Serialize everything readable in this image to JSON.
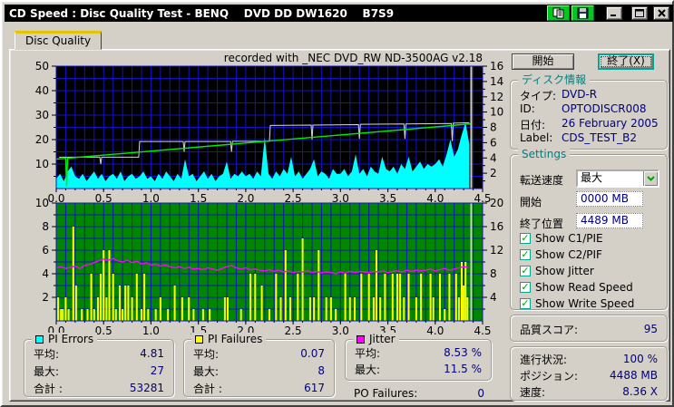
{
  "window": {
    "title": "CD Speed : Disc Quality Test - BENQ    DVD DD DW1620    B7S9"
  },
  "colors": {
    "window_bg": "#d4d0c8",
    "titlebar": "#000000",
    "value_text": "#000080",
    "group_title": "#008080",
    "default_button_border": "#00a693",
    "check_green": "#00a000"
  },
  "icons": {
    "check_glyph": "✓"
  },
  "tab": {
    "label": "Disc Quality"
  },
  "chart_header": "recorded with _NEC      DVD_RW ND-3500AG v2.18",
  "buttons": {
    "start": "開始",
    "exit": "終了(X)"
  },
  "disc_info": {
    "title": "ディスク情報",
    "rows": [
      {
        "label": "タイプ:",
        "value": "DVD-R"
      },
      {
        "label": "ID:",
        "value": "OPTODISCR008"
      },
      {
        "label": "日付:",
        "value": "26 February 2005"
      },
      {
        "label": "Label:",
        "value": "CDS_TEST_B2"
      }
    ]
  },
  "settings": {
    "title": "Settings",
    "speed_label": "転送速度",
    "speed_value": "最大",
    "start_label": "開始",
    "start_value": "0000 MB",
    "end_label": "終了位置",
    "end_value": "4489 MB",
    "checkboxes": [
      {
        "label": "Show C1/PIE",
        "checked": true
      },
      {
        "label": "Show C2/PIF",
        "checked": true
      },
      {
        "label": "Show Jitter",
        "checked": true
      },
      {
        "label": "Show Read Speed",
        "checked": true
      },
      {
        "label": "Show Write Speed",
        "checked": true
      }
    ]
  },
  "quality": {
    "label": "品質スコア:",
    "value": "95"
  },
  "progress": {
    "rows": [
      {
        "label": "進行状況:",
        "value": "100 %"
      },
      {
        "label": "ポジション:",
        "value": "4488 MB"
      },
      {
        "label": "速度:",
        "value": "8.36 X"
      }
    ]
  },
  "stats": {
    "pi_errors": {
      "title": "PI Errors",
      "swatch": "#00ffff",
      "rows": [
        {
          "label": "平均:",
          "value": "4.81"
        },
        {
          "label": "最大:",
          "value": "27"
        },
        {
          "label": "合計 :",
          "value": "53281"
        }
      ]
    },
    "pi_failures": {
      "title": "PI Failures",
      "swatch": "#ffff00",
      "rows": [
        {
          "label": "平均:",
          "value": "0.07"
        },
        {
          "label": "最大:",
          "value": "8"
        },
        {
          "label": "合計 :",
          "value": "617"
        }
      ]
    },
    "jitter": {
      "title": "Jitter",
      "swatch": "#ff00ff",
      "rows": [
        {
          "label": "平均:",
          "value": "8.53 %"
        },
        {
          "label": "最大:",
          "value": "11.5 %"
        }
      ]
    },
    "po_failures": {
      "label": "PO Failures:",
      "value": "0"
    }
  },
  "chart_data": [
    {
      "type": "area",
      "name": "pi-errors-and-speed",
      "bg": "#000000",
      "grid": "#1212c8",
      "marker_x": 4.38,
      "marker_color": "#cccccc",
      "x_range": [
        0,
        4.5
      ],
      "x_ticks": [
        0,
        0.5,
        1,
        1.5,
        2,
        2.5,
        3,
        3.5,
        4,
        4.5
      ],
      "x_minor_step": 0.1,
      "left_axis": {
        "range": [
          0,
          50
        ],
        "ticks": [
          10,
          20,
          30,
          40,
          50
        ],
        "grid_step": 5
      },
      "right_axis": {
        "range": [
          0,
          16
        ],
        "ticks": [
          2,
          4,
          6,
          8,
          10,
          12,
          14,
          16
        ]
      },
      "series": [
        {
          "name": "PI Errors",
          "type": "area",
          "axis": "left",
          "color": "#00ffff",
          "x_start": 0,
          "x_step": 0.04,
          "values": [
            4,
            6,
            3,
            7,
            9,
            5,
            4,
            6,
            3,
            5,
            7,
            4,
            6,
            3,
            5,
            6,
            4,
            7,
            3,
            5,
            6,
            4,
            5,
            7,
            4,
            5,
            3,
            6,
            4,
            7,
            5,
            3,
            6,
            4,
            12,
            5,
            6,
            3,
            5,
            7,
            4,
            6,
            3,
            5,
            6,
            11,
            4,
            6,
            5,
            7,
            5,
            6,
            4,
            7,
            5,
            21,
            6,
            4,
            7,
            5,
            8,
            6,
            13,
            5,
            7,
            4,
            6,
            8,
            12,
            5,
            7,
            6,
            4,
            8,
            6,
            6,
            8,
            5,
            7,
            14,
            6,
            8,
            5,
            9,
            7,
            6,
            13,
            8,
            7,
            9,
            6,
            10,
            8,
            13,
            7,
            9,
            11,
            8,
            10,
            9,
            10,
            12,
            9,
            14,
            20,
            13,
            16,
            22,
            27,
            18
          ]
        },
        {
          "name": "Write Speed",
          "type": "line",
          "axis": "right",
          "color": "#d8d8d8",
          "width": 1,
          "points": [
            [
              0.03,
              4.1
            ],
            [
              0.46,
              4.1
            ],
            [
              0.47,
              3.2
            ],
            [
              0.48,
              4.1
            ],
            [
              0.87,
              4.1
            ],
            [
              0.88,
              6.15
            ],
            [
              1.34,
              6.15
            ],
            [
              1.35,
              4.8
            ],
            [
              1.36,
              6.15
            ],
            [
              1.84,
              6.15
            ],
            [
              1.85,
              4.8
            ],
            [
              1.86,
              6.18
            ],
            [
              2.25,
              6.18
            ],
            [
              2.26,
              8.25
            ],
            [
              2.69,
              8.3
            ],
            [
              2.7,
              6.4
            ],
            [
              2.71,
              8.3
            ],
            [
              3.19,
              8.35
            ],
            [
              3.2,
              6.5
            ],
            [
              3.21,
              8.4
            ],
            [
              3.67,
              8.45
            ],
            [
              3.68,
              6.5
            ],
            [
              3.69,
              8.45
            ],
            [
              4.17,
              8.5
            ],
            [
              4.18,
              6.2
            ],
            [
              4.19,
              8.55
            ],
            [
              4.36,
              8.6
            ]
          ]
        },
        {
          "name": "Read Speed",
          "type": "line",
          "axis": "right",
          "color": "#00ee00",
          "width": 1.4,
          "points": [
            [
              0,
              3.85
            ],
            [
              0.1,
              3.95
            ],
            [
              0.11,
              0.3
            ],
            [
              0.12,
              3.97
            ],
            [
              4.37,
              8.45
            ]
          ]
        }
      ]
    },
    {
      "type": "bar",
      "name": "pi-failures-and-jitter",
      "bg": "#008700",
      "grid": "#1212c8",
      "marker_x": 4.38,
      "marker_color": "#cccccc",
      "x_range": [
        0,
        4.5
      ],
      "x_ticks": [
        0,
        0.5,
        1,
        1.5,
        2,
        2.5,
        3,
        3.5,
        4,
        4.5
      ],
      "x_minor_step": 0.1,
      "left_axis": {
        "range": [
          0,
          10
        ],
        "ticks": [
          2,
          4,
          6,
          8,
          10
        ],
        "grid_step": 1
      },
      "right_axis": {
        "range": [
          0,
          20
        ],
        "ticks": [
          4,
          8,
          12,
          16,
          20
        ]
      },
      "series": [
        {
          "name": "PI Failures",
          "type": "bars",
          "axis": "left",
          "color": "#ffff00",
          "points": [
            [
              0.02,
              2
            ],
            [
              0.05,
              1
            ],
            [
              0.07,
              1
            ],
            [
              0.1,
              2
            ],
            [
              0.13,
              1
            ],
            [
              0.18,
              8
            ],
            [
              0.21,
              3
            ],
            [
              0.27,
              1
            ],
            [
              0.33,
              1
            ],
            [
              0.37,
              4
            ],
            [
              0.4,
              1
            ],
            [
              0.44,
              2
            ],
            [
              0.47,
              4
            ],
            [
              0.5,
              6
            ],
            [
              0.53,
              2
            ],
            [
              0.56,
              6
            ],
            [
              0.6,
              4
            ],
            [
              0.63,
              1
            ],
            [
              0.67,
              3
            ],
            [
              0.7,
              1
            ],
            [
              0.73,
              3
            ],
            [
              0.76,
              3
            ],
            [
              0.8,
              2
            ],
            [
              0.85,
              4
            ],
            [
              0.9,
              1
            ],
            [
              0.93,
              4
            ],
            [
              0.97,
              1
            ],
            [
              1.05,
              1
            ],
            [
              1.1,
              2
            ],
            [
              1.18,
              1
            ],
            [
              1.25,
              3
            ],
            [
              1.33,
              2
            ],
            [
              1.4,
              2
            ],
            [
              1.45,
              1
            ],
            [
              1.55,
              1
            ],
            [
              1.62,
              1
            ],
            [
              1.78,
              2
            ],
            [
              1.81,
              2
            ],
            [
              1.95,
              1
            ],
            [
              2.05,
              4
            ],
            [
              2.1,
              4
            ],
            [
              2.17,
              3
            ],
            [
              2.25,
              1
            ],
            [
              2.32,
              4
            ],
            [
              2.37,
              2
            ],
            [
              2.42,
              6
            ],
            [
              2.47,
              2
            ],
            [
              2.55,
              4
            ],
            [
              2.6,
              7
            ],
            [
              2.68,
              2
            ],
            [
              2.72,
              2
            ],
            [
              2.77,
              6
            ],
            [
              2.85,
              2
            ],
            [
              2.9,
              2
            ],
            [
              2.95,
              1
            ],
            [
              3.05,
              4
            ],
            [
              3.1,
              2
            ],
            [
              3.15,
              2
            ],
            [
              3.22,
              4
            ],
            [
              3.3,
              4
            ],
            [
              3.35,
              2
            ],
            [
              3.38,
              6
            ],
            [
              3.42,
              2
            ],
            [
              3.47,
              4
            ],
            [
              3.55,
              4
            ],
            [
              3.6,
              4
            ],
            [
              3.63,
              4
            ],
            [
              3.67,
              2
            ],
            [
              3.72,
              4
            ],
            [
              3.8,
              2
            ],
            [
              3.85,
              4
            ],
            [
              3.95,
              4
            ],
            [
              3.98,
              2
            ],
            [
              4.05,
              4
            ],
            [
              4.1,
              1
            ],
            [
              4.15,
              4
            ],
            [
              4.22,
              4
            ],
            [
              4.25,
              2
            ],
            [
              4.28,
              5
            ],
            [
              4.3,
              3
            ],
            [
              4.32,
              5
            ],
            [
              4.34,
              2
            ]
          ]
        },
        {
          "name": "Jitter",
          "type": "line",
          "axis": "right",
          "color": "#ff00ff",
          "width": 1.4,
          "x_start": 0,
          "x_step": 0.05,
          "values": [
            9.0,
            9.2,
            8.9,
            9.1,
            9.3,
            8.9,
            9.4,
            9.6,
            9.9,
            10.2,
            10.5,
            10.3,
            10.6,
            10.2,
            10.0,
            10.3,
            9.9,
            10.1,
            9.7,
            9.9,
            9.5,
            9.6,
            9.3,
            9.5,
            9.2,
            9.0,
            9.2,
            8.9,
            9.1,
            8.8,
            8.9,
            8.7,
            9.0,
            8.8,
            8.6,
            8.9,
            9.2,
            9.4,
            9.0,
            8.8,
            9.0,
            8.7,
            8.8,
            8.6,
            8.5,
            8.7,
            8.4,
            8.6,
            8.3,
            8.5,
            8.2,
            8.4,
            8.3,
            8.5,
            8.2,
            8.4,
            8.1,
            8.3,
            8.2,
            8.0,
            8.3,
            8.1,
            8.4,
            8.2,
            8.4,
            8.3,
            8.2,
            8.4,
            8.3,
            8.5,
            8.2,
            8.4,
            8.5,
            8.3,
            8.6,
            8.4,
            8.6,
            8.5,
            8.6,
            8.8,
            8.5,
            8.7,
            8.9,
            8.6,
            8.8,
            9.0,
            9.2,
            9.1
          ]
        }
      ]
    }
  ]
}
